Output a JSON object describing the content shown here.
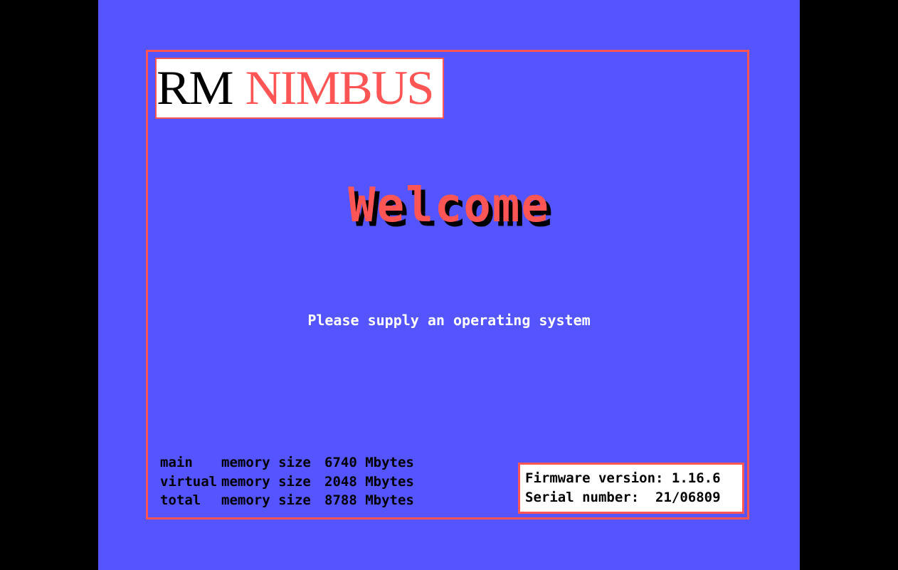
{
  "logo": {
    "rm": "RM",
    "nimbus": "NIMBUS"
  },
  "welcome": "Welcome",
  "prompt": "Please supply an operating system",
  "memory": [
    {
      "label": "main",
      "kind": "memory size",
      "value": "6740 Mbytes"
    },
    {
      "label": "virtual",
      "kind": "memory size",
      "value": "2048 Mbytes"
    },
    {
      "label": "total",
      "kind": "memory size",
      "value": "8788 Mbytes"
    }
  ],
  "firmware": {
    "version_line": "Firmware version: 1.16.6",
    "serial_line": "Serial number:  21/06809"
  },
  "colors": {
    "background": "#5555ff",
    "accent": "#ff5555",
    "letterbox": "#000000"
  }
}
